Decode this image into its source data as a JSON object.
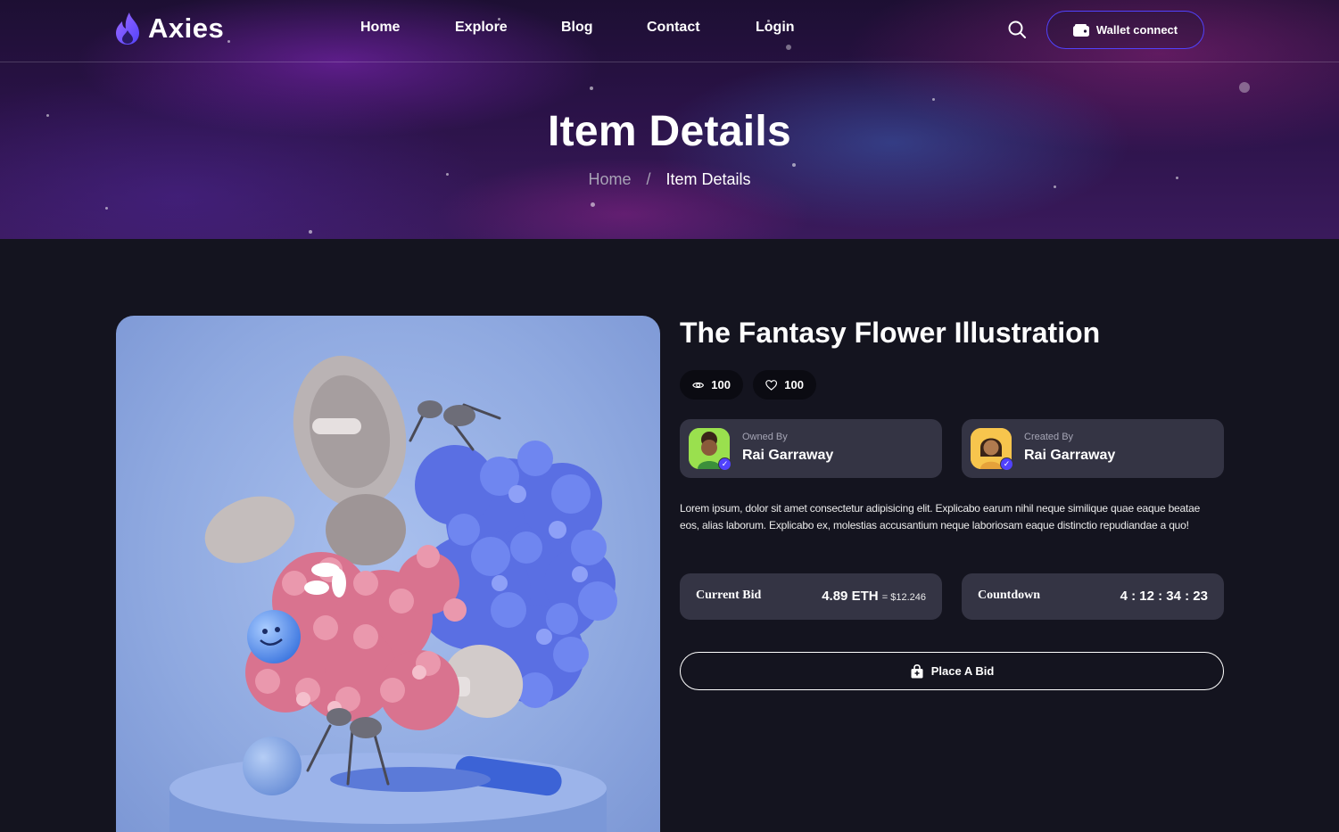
{
  "brand": {
    "name": "Axies"
  },
  "nav": [
    {
      "label": "Home"
    },
    {
      "label": "Explore"
    },
    {
      "label": "Blog"
    },
    {
      "label": "Contact"
    },
    {
      "label": "Login"
    }
  ],
  "header": {
    "search_icon": "search-icon",
    "wallet_label": "Wallet connect"
  },
  "hero": {
    "title": "Item Details",
    "breadcrumb": {
      "home": "Home",
      "separator": "/",
      "current": "Item Details"
    }
  },
  "item": {
    "title": "The Fantasy Flower Illustration",
    "views": "100",
    "likes": "100",
    "owner": {
      "role": "Owned By",
      "name": "Rai Garraway"
    },
    "creator": {
      "role": "Created By",
      "name": "Rai Garraway"
    },
    "description": "Lorem ipsum, dolor sit amet consectetur adipisicing elit. Explicabo earum nihil neque similique quae eaque beatae eos, alias laborum. Explicabo ex, molestias accusantium neque laboriosam eaque distinctio repudiandae a quo!",
    "current_bid": {
      "label": "Current Bid",
      "eth": "4.89 ETH",
      "usd": "= $12.246"
    },
    "countdown": {
      "label": "Countdown",
      "value": "4 : 12 : 34 : 23"
    },
    "place_bid_label": "Place A Bid"
  },
  "colors": {
    "accent": "#5142fc",
    "background": "#14141f",
    "card": "#343444"
  }
}
